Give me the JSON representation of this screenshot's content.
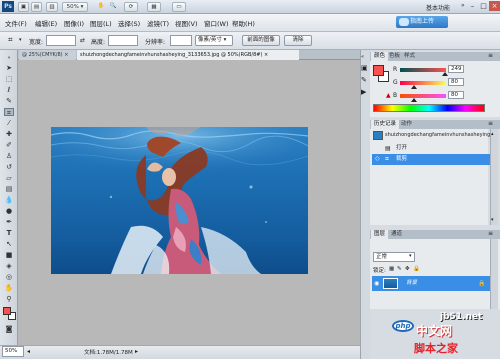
{
  "app": {
    "logo": "Ps",
    "zoom_display": "50%",
    "workspace": "基本功能",
    "cs_live": "指南上传",
    "window_controls": [
      "–",
      "□",
      "×"
    ]
  },
  "menu": [
    "文件(F)",
    "编辑(E)",
    "图像(I)",
    "图层(L)",
    "选择(S)",
    "滤镜(T)",
    "视图(V)",
    "窗口(W)",
    "帮助(H)"
  ],
  "options_bar": {
    "width_label": "宽度:",
    "height_label": "高度:",
    "resolution_label": "分辨率:",
    "units_value": "像素/英寸",
    "front_image_button": "前面的图像",
    "clear_button": "清除"
  },
  "document_tabs": [
    {
      "label": "@ 25%(CMYK/8) ×"
    },
    {
      "label": "shuizhongdechangfameinvhunshasheying_3133653.jpg @ 50%(RGB/8#) ×"
    }
  ],
  "status_bar": {
    "zoom": "50%",
    "doc_size": "文档:1.78M/1.78M"
  },
  "color_panel": {
    "tabs": [
      "颜色",
      "色板",
      "样式"
    ],
    "channels": [
      {
        "label": "R",
        "value": "249",
        "fraction": 0.976
      },
      {
        "label": "G",
        "value": "80",
        "fraction": 0.314
      },
      {
        "label": "B",
        "value": "80",
        "fraction": 0.314
      }
    ],
    "foreground_color": "#f95050"
  },
  "history_panel": {
    "tabs": [
      "历史记录",
      "动作"
    ],
    "snapshot_label": "shuizhongdechangfameinvhunshasheying...",
    "items": [
      "打开",
      "裁剪"
    ],
    "active_index": 1
  },
  "layers_panel": {
    "tabs": [
      "图层",
      "通道"
    ],
    "blend_mode": "正常",
    "lock_label": "锁定:",
    "layers": [
      {
        "name": "背景",
        "selected": true
      }
    ]
  },
  "watermark": {
    "php": "php",
    "zhongwen": "中文网",
    "site": "jb51.net",
    "sub": "脚本之家"
  },
  "colors": {
    "selection_blue": "#3a8ee6",
    "panel_bg": "#d6dce2",
    "canvas_bg": "#b8b8b8"
  }
}
